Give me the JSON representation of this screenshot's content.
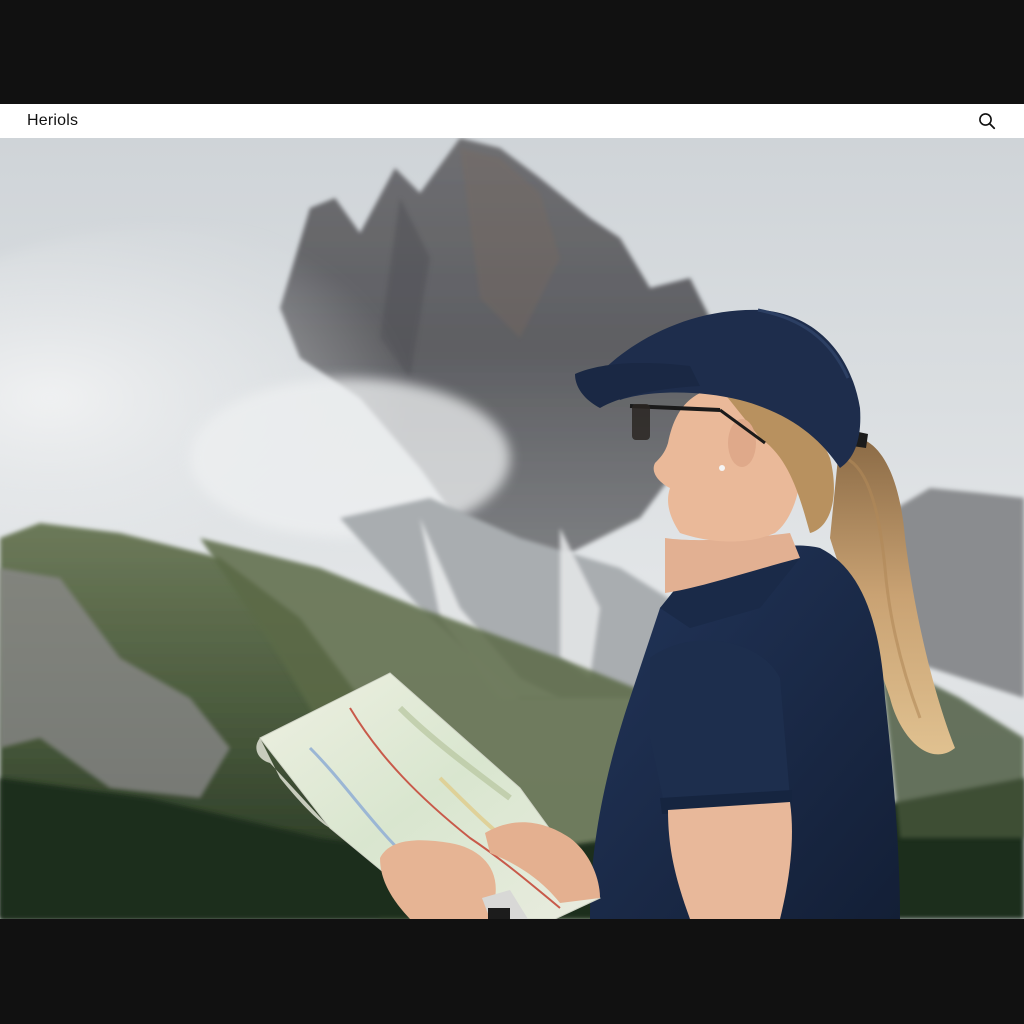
{
  "header": {
    "brand": "Heriols",
    "search_icon": "search-icon"
  },
  "hero": {
    "image_icon": "hero-photo"
  },
  "colors": {
    "header_bg": "#ffffff",
    "letterbox": "#111111",
    "sky": "#d9dde0",
    "navy": "#1c2d4a"
  }
}
